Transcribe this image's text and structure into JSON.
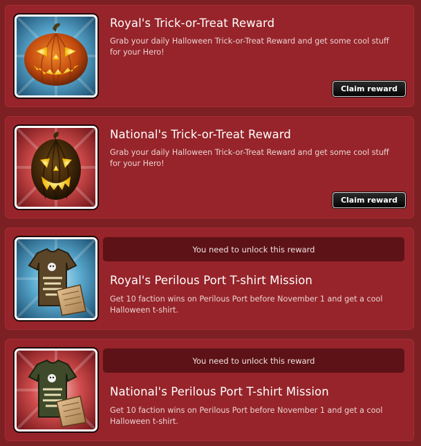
{
  "rewards": [
    {
      "title": "Royal's Trick-or-Treat Reward",
      "description": "Grab your daily Halloween Trick-or-Treat Reward and get some cool stuff for your Hero!",
      "button_label": "Claim reward",
      "icon": "pumpkin-icon",
      "theme_color": "#3b8fb8"
    },
    {
      "title": "National's Trick-or-Treat Reward",
      "description": "Grab your daily Halloween Trick-or-Treat Reward and get some cool stuff for your Hero!",
      "button_label": "Claim reward",
      "icon": "pumpkin-icon",
      "theme_color": "#b81e2a"
    },
    {
      "locked_text": "You need to unlock this reward",
      "title": "Royal's Perilous Port T-shirt Mission",
      "description": "Get 10 faction wins on Perilous Port before November 1 and get a cool Halloween t-shirt.",
      "icon": "tshirt-icon",
      "theme_color": "#3b8fb8"
    },
    {
      "locked_text": "You need to unlock this reward",
      "title": "National's Perilous Port T-shirt Mission",
      "description": "Get 10 faction wins on Perilous Port before November 1 and get a cool Halloween t-shirt.",
      "icon": "tshirt-icon",
      "theme_color": "#b81e2a"
    }
  ]
}
